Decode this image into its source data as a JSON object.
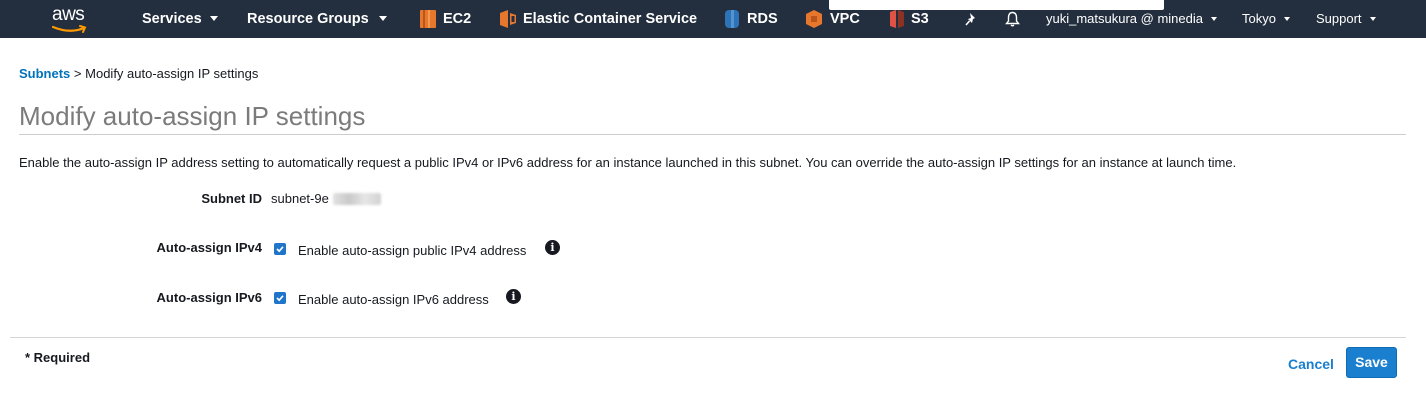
{
  "nav": {
    "logo_text": "aws",
    "services": "Services",
    "resource_groups": "Resource Groups",
    "ec2": "EC2",
    "ecs": "Elastic Container Service",
    "rds": "RDS",
    "vpc": "VPC",
    "s3": "S3",
    "user": "yuki_matsukura @ minedia",
    "region": "Tokyo",
    "support": "Support",
    "icons": [
      "pin-icon",
      "bell-icon"
    ],
    "bg_color": "#232f3e"
  },
  "breadcrumb": {
    "link": "Subnets",
    "separator": ">",
    "current": "Modify auto-assign IP settings"
  },
  "page": {
    "title": "Modify auto-assign IP settings",
    "description": "Enable the auto-assign IP address setting to automatically request a public IPv4 or IPv6 address for an instance launched in this subnet. You can override the auto-assign IP settings for an instance at launch time."
  },
  "form": {
    "subnet_id_label": "Subnet ID",
    "subnet_id_value": "subnet-9e",
    "ipv4_label": "Auto-assign IPv4",
    "ipv4_checkbox_label": "Enable auto-assign public IPv4 address",
    "ipv4_checked": true,
    "ipv6_label": "Auto-assign IPv6",
    "ipv6_checkbox_label": "Enable auto-assign IPv6 address",
    "ipv6_checked": true
  },
  "footer": {
    "required": "* Required",
    "cancel": "Cancel",
    "save": "Save"
  },
  "colors": {
    "link": "#0073bb",
    "primary_button": "#1a7fcf",
    "title": "#7b7b7b"
  }
}
